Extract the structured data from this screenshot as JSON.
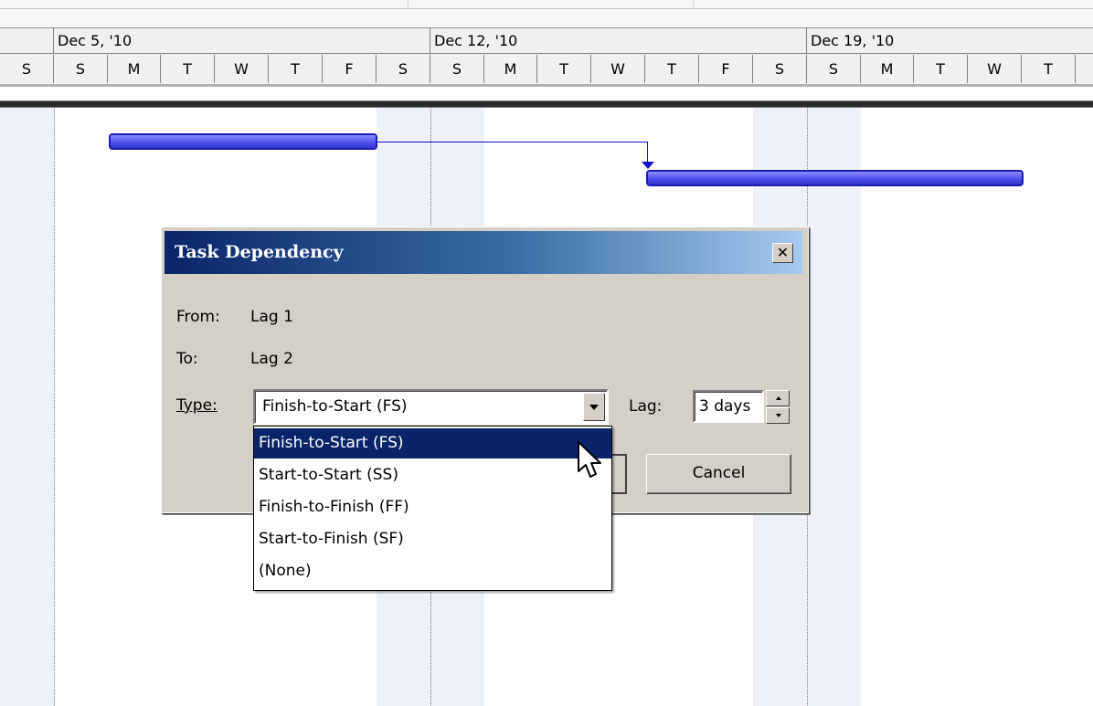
{
  "timescale": {
    "weeks": [
      "Dec 5, '10",
      "Dec 12, '10",
      "Dec 19, '10"
    ],
    "days": [
      "S",
      "S",
      "M",
      "T",
      "W",
      "T",
      "F",
      "S",
      "S",
      "M",
      "T",
      "W",
      "T",
      "F",
      "S",
      "S",
      "M",
      "T",
      "W",
      "T"
    ]
  },
  "dialog": {
    "title": "Task Dependency",
    "close_symbol": "✕",
    "from_label": "From:",
    "from_value": "Lag 1",
    "to_label": "To:",
    "to_value": "Lag 2",
    "type_label": "Type:",
    "type_selected": "Finish-to-Start (FS)",
    "lag_label": "Lag:",
    "lag_value": "3 days",
    "cancel_label": "Cancel"
  },
  "type_options": [
    "Finish-to-Start (FS)",
    "Start-to-Start (SS)",
    "Finish-to-Finish (FF)",
    "Start-to-Finish (SF)",
    "(None)"
  ],
  "icons": {
    "close": "close-icon",
    "dropdown": "chevron-down-icon",
    "spin_up": "spin-up-icon",
    "spin_down": "spin-down-icon",
    "cursor": "arrow-cursor-icon"
  },
  "colors": {
    "titlebar_start": "#0a246a",
    "titlebar_end": "#a6caf0",
    "selection": "#0a246a",
    "gantt_bar": "#4f52ee",
    "link_line": "#1010c0"
  }
}
